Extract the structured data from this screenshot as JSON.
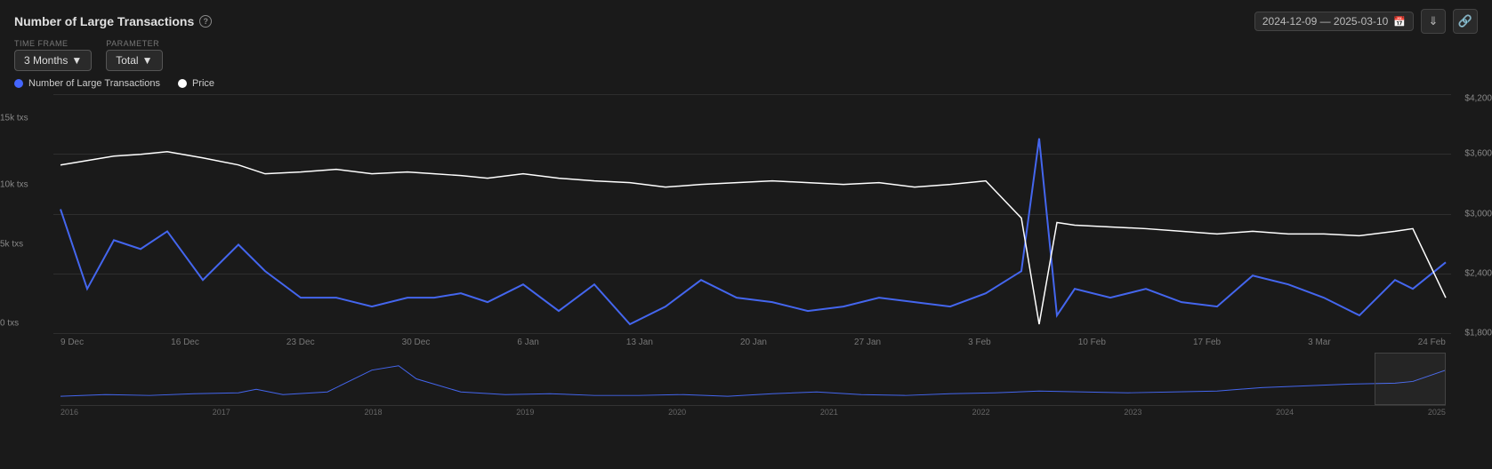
{
  "header": {
    "title": "Number of Large Transactions",
    "info_icon": "ℹ",
    "date_range": "2024-12-09 — 2025-03-10",
    "calendar_icon": "📅",
    "download_icon": "⬇",
    "share_icon": "🔗"
  },
  "controls": {
    "time_frame_label": "TIME FRAME",
    "time_frame_value": "3 Months",
    "parameter_label": "PARAMETER",
    "parameter_value": "Total"
  },
  "legend": {
    "items": [
      {
        "label": "Number of Large Transactions",
        "color": "#4466ff",
        "shape": "circle"
      },
      {
        "label": "Price",
        "color": "#ffffff",
        "shape": "circle"
      }
    ]
  },
  "chart": {
    "y_labels_left": [
      "15k txs",
      "10k txs",
      "5k txs",
      "0 txs"
    ],
    "y_labels_right": [
      "$4,200",
      "$3,600",
      "$3,000",
      "$2,400",
      "$1,800"
    ],
    "x_labels": [
      "9 Dec",
      "16 Dec",
      "23 Dec",
      "30 Dec",
      "6 Jan",
      "13 Jan",
      "20 Jan",
      "27 Jan",
      "3 Feb",
      "10 Feb",
      "17 Feb",
      "3 Mar",
      "24 Feb"
    ]
  },
  "mini_chart": {
    "x_labels": [
      "2016",
      "2017",
      "2018",
      "2019",
      "2020",
      "2021",
      "2022",
      "2023",
      "2024",
      "2025"
    ]
  }
}
